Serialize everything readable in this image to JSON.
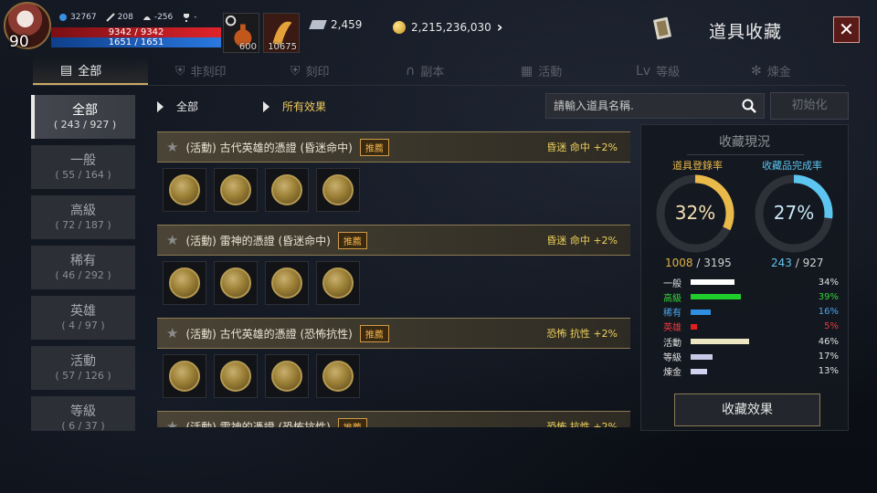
{
  "player": {
    "level": "90",
    "power": "32767",
    "stat_a": "208",
    "stat_b": "-256",
    "stat_c": "-",
    "hp": "9342 / 9342",
    "mp": "1651 / 1651"
  },
  "slots": [
    {
      "count": "600"
    },
    {
      "count": "10675"
    }
  ],
  "currency": {
    "gems": "2,459",
    "gold": "2,215,236,030"
  },
  "header": {
    "title": "道具收藏",
    "close_label": "✕"
  },
  "tabs": [
    {
      "label": "全部",
      "icon": "book-icon"
    },
    {
      "label": "非刻印",
      "icon": "shield-off-icon"
    },
    {
      "label": "刻印",
      "icon": "shield-icon"
    },
    {
      "label": "副本",
      "icon": "helmet-icon"
    },
    {
      "label": "活動",
      "icon": "gift-icon"
    },
    {
      "label": "等級",
      "icon": "level-icon"
    },
    {
      "label": "煉金",
      "icon": "alchemy-icon"
    }
  ],
  "categories": [
    {
      "name": "全部",
      "count": "( 243 / 927 )"
    },
    {
      "name": "一般",
      "count": "( 55 / 164 )"
    },
    {
      "name": "高級",
      "count": "( 72 / 187 )"
    },
    {
      "name": "稀有",
      "count": "( 46 / 292 )"
    },
    {
      "name": "英雄",
      "count": "( 4 / 97 )"
    },
    {
      "name": "活動",
      "count": "( 57 / 126 )"
    },
    {
      "name": "等級",
      "count": "( 6 / 37 )"
    }
  ],
  "filters": {
    "scope": "全部",
    "effect": "所有效果",
    "search_placeholder": "請輸入道具名稱.",
    "reset_label": "初始化"
  },
  "entries": [
    {
      "title": "(活動) 古代英雄的憑證 (昏迷命中)",
      "badge": "推薦",
      "effect": "昏迷 命中 +2%"
    },
    {
      "title": "(活動) 雷神的憑證 (昏迷命中)",
      "badge": "推薦",
      "effect": "昏迷 命中 +2%"
    },
    {
      "title": "(活動) 古代英雄的憑證 (恐怖抗性)",
      "badge": "推薦",
      "effect": "恐怖 抗性 +2%"
    },
    {
      "title": "(活動) 雷神的憑證 (恐怖抗性)",
      "badge": "推薦",
      "effect": "恐怖 抗性 +2%"
    }
  ],
  "status": {
    "title": "收藏現況",
    "reg_label": "道具登錄率",
    "comp_label": "收藏品完成率",
    "reg_pct": "32%",
    "comp_pct": "27%",
    "reg_value": 0.32,
    "comp_value": 0.27,
    "reg_num": "1008",
    "reg_total": " / 3195",
    "comp_num": "243",
    "comp_total": " / 927",
    "colors": {
      "reg": "#e9b94a",
      "comp": "#5cc6f0"
    },
    "rows": [
      {
        "name": "一般",
        "pct": "34%",
        "value": 0.34,
        "color": "#ffffff",
        "text_color": "#e0e0e0"
      },
      {
        "name": "高級",
        "pct": "39%",
        "value": 0.39,
        "color": "#1fce2c",
        "text_color": "#32d43a"
      },
      {
        "name": "稀有",
        "pct": "16%",
        "value": 0.16,
        "color": "#2f8fe0",
        "text_color": "#4aa6ee"
      },
      {
        "name": "英雄",
        "pct": "5%",
        "value": 0.05,
        "color": "#e01f1f",
        "text_color": "#e83a3a"
      },
      {
        "name": "活動",
        "pct": "46%",
        "value": 0.46,
        "color": "#ece6c2",
        "text_color": "#e0e0e0"
      },
      {
        "name": "等級",
        "pct": "17%",
        "value": 0.17,
        "color": "#c8c8e6",
        "text_color": "#e0e0e0"
      },
      {
        "name": "煉金",
        "pct": "13%",
        "value": 0.13,
        "color": "#d2d2f0",
        "text_color": "#e0e0e0"
      }
    ],
    "button_label": "收藏效果"
  }
}
